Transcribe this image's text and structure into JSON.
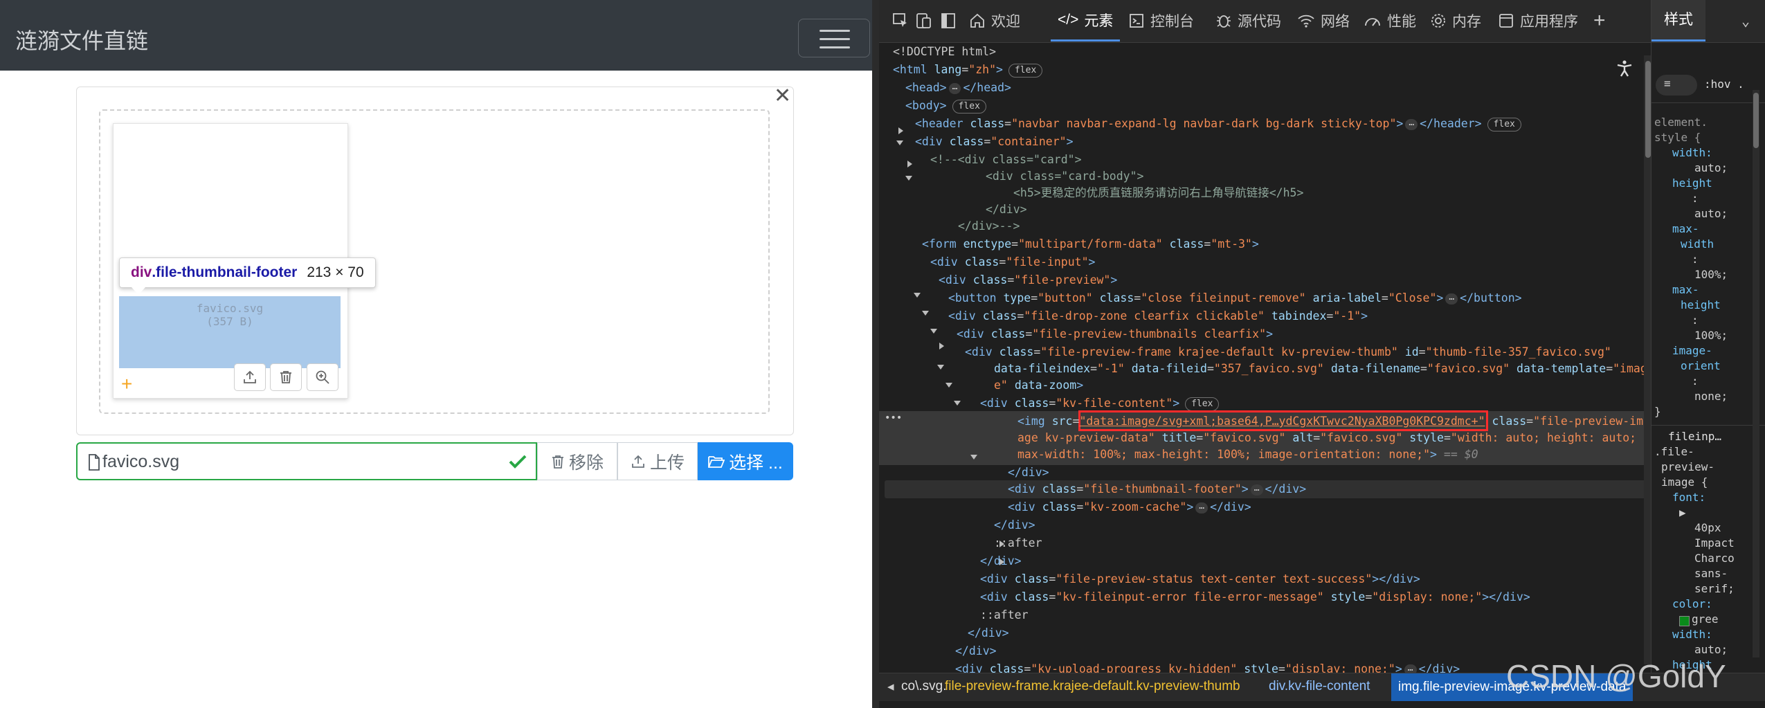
{
  "site": {
    "brand": "涟漪文件直链",
    "thumbnail": {
      "filename": "favico.svg",
      "size": "(357 B)"
    },
    "tooltip": {
      "tag": "div",
      "class": ".file-thumbnail-footer",
      "dims": "213 × 70"
    },
    "caption": {
      "filename": "favico.svg"
    },
    "buttons": {
      "remove": "移除",
      "upload": "上传",
      "browse": "选择 ..."
    }
  },
  "devtools": {
    "tabs": [
      {
        "label": "欢迎"
      },
      {
        "label": "元素"
      },
      {
        "label": "控制台"
      },
      {
        "label": "源代码"
      },
      {
        "label": "网络"
      },
      {
        "label": "性能"
      },
      {
        "label": "内存"
      },
      {
        "label": "应用程序"
      }
    ],
    "active_tab": "元素",
    "styles_panel": {
      "title": "样式",
      "filter": ":hov .",
      "lines": [
        "element.",
        "style {",
        "width:",
        "auto;",
        "height",
        ":",
        "auto;",
        "max-",
        "width",
        ":",
        "100%;",
        "max-",
        "height",
        ":",
        "100%;",
        "image-",
        "orient",
        ":",
        "none;",
        "}"
      ],
      "rule2": [
        "fileinp…",
        ".file-",
        "preview-",
        "image {",
        "font:",
        "40px",
        "Impact",
        "Charco",
        "sans-",
        "serif;",
        "color:",
        "gree",
        "width:",
        "auto;",
        "height"
      ]
    },
    "breadcrumbs": [
      "co\\.svg.",
      "file-preview-frame.krajee-default.kv-preview-thumb",
      "div.kv-file-content",
      "img.file-preview-image.kv-preview-data"
    ],
    "dom_lines": [
      "<!DOCTYPE html>",
      "<html lang=\"zh\">",
      "<head> … </head>",
      "<body>",
      "<header class=\"navbar navbar-expand-lg navbar-dark bg-dark sticky-top\"> … </header>",
      "<div class=\"container\">",
      "<!--<div class=\"card\">",
      "<div class=\"card-body\">",
      "<h5>更稳定的优质直链服务请访问右上角导航链接</h5>",
      "</div>",
      "</div>-->",
      "<form enctype=\"multipart/form-data\" class=\"mt-3\">",
      "<div class=\"file-input\">",
      "<div class=\"file-preview\">",
      "<button type=\"button\" class=\"close fileinput-remove\" aria-label=\"Close\"> … </button>",
      "<div class=\"file-drop-zone clearfix clickable\" tabindex=\"-1\">",
      "<div class=\"file-preview-thumbnails clearfix\">",
      "<div class=\"file-preview-frame krajee-default  kv-preview-thumb\" id=\"thumb-file-357_favico.svg\"",
      "data-fileindex=\"-1\" data-fileid=\"357_favico.svg\" data-filename=\"favico.svg\" data-template=\"imag",
      "e\" data-zoom>",
      "<div class=\"kv-file-content\">",
      "<img src=\"data:image/svg+xml;base64,P…ydCgxKTwvc2NyaXB0Pg0KPC9zdmc+\" class=\"file-preview-im",
      "age kv-preview-data\" title=\"favico.svg\" alt=\"favico.svg\" style=\"width: auto; height: auto;",
      "max-width: 100%; max-height: 100%; image-orientation: none;\"> == $0",
      "</div>",
      "<div class=\"file-thumbnail-footer\"> … </div>",
      "<div class=\"kv-zoom-cache\"> … </div>",
      "</div>",
      "::after",
      "</div>",
      "<div class=\"file-preview-status text-center text-success\"></div>",
      "<div class=\"kv-fileinput-error file-error-message\" style=\"display: none;\"></div>",
      "::after",
      "</div>",
      "</div>",
      "<div class=\"kv-upload-progress kv-hidden\" style=\"display: none;\"> … </div>"
    ],
    "flex_badge": "flex",
    "dom_marker": "$0"
  },
  "watermark": "CSDN @GoldY"
}
